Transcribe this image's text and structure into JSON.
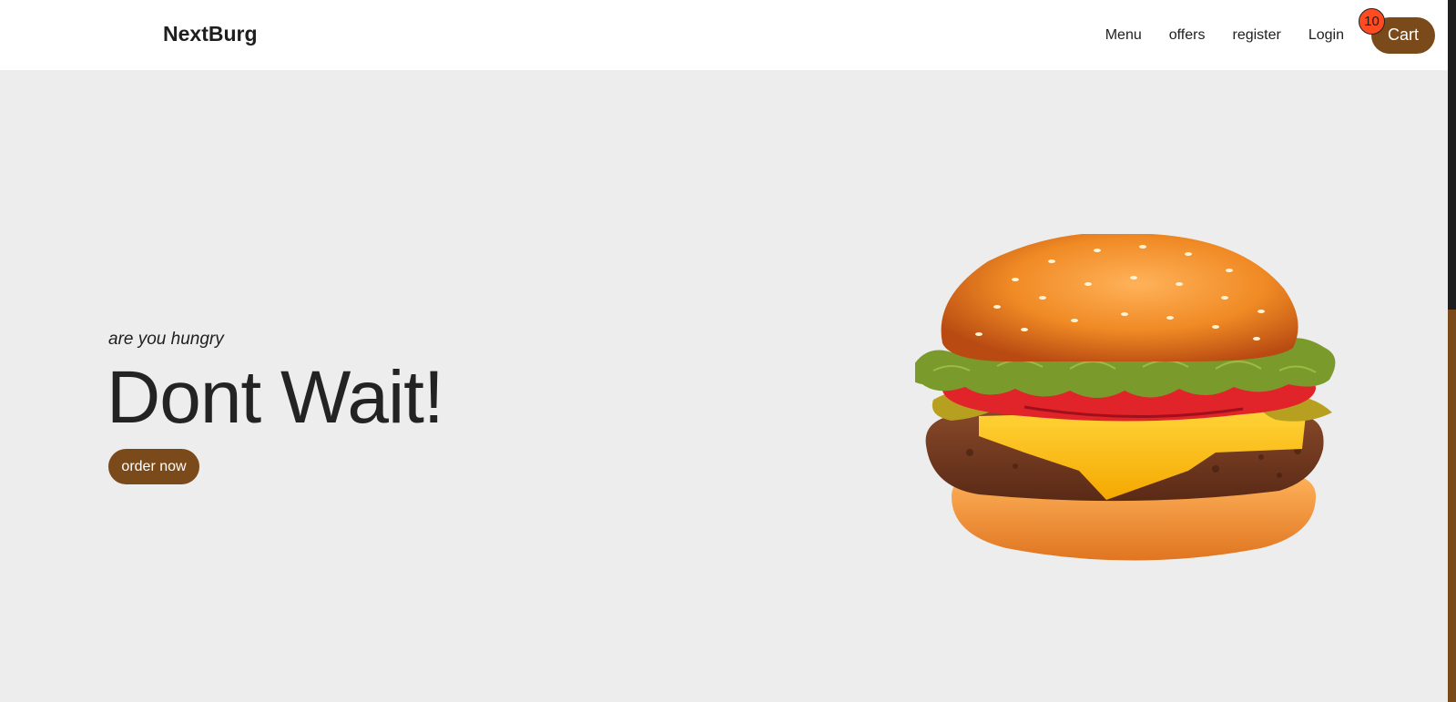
{
  "brand": {
    "name": "NextBurg"
  },
  "nav": {
    "links": [
      "Menu",
      "offers",
      "register",
      "Login"
    ],
    "cart_label": "Cart",
    "cart_count": "10"
  },
  "hero": {
    "subtitle": "are you hungry",
    "title": "Dont Wait!",
    "cta_label": "order now"
  },
  "images": {
    "hero_image": "burger-illustration"
  },
  "colors": {
    "accent": "#7b4a1b",
    "badge": "#ff4b1f",
    "hero_bg": "#ededed",
    "nav_bg": "#ffffff"
  }
}
